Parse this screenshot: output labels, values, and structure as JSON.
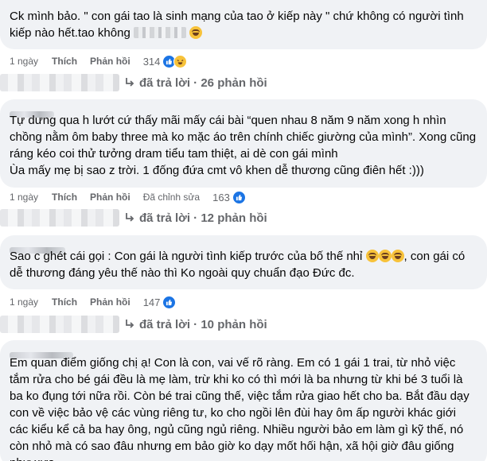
{
  "comments": [
    {
      "text_before": "Ck mình bảo. \" con gái tao là sinh mạng của tao ở kiếp này \" chứ không có người tình kiếp nào hết.tao không",
      "time": "1 ngày",
      "like": "Thích",
      "reply": "Phản hồi",
      "reaction_count": "314",
      "reactions": [
        "like-icon",
        "haha-icon"
      ],
      "replies_label": "đã trả lời · 26 phản hồi"
    },
    {
      "text": "Tự dưng qua h lướt cứ thấy mãi mấy cái bài “quen nhau 8 năm 9 năm xong h nhìn chồng nằm ôm baby three mà ko mặc áo trên chính chiếc giường của mình”. Xong cũng ráng kéo coi thử tưởng dram tiểu tam thiệt, ai dè con gái mình\nÙa mấy mẹ bị sao z trời. 1 đống đứa cmt vô khen dễ thương cũng điên hết :)))",
      "time": "1 ngày",
      "like": "Thích",
      "reply": "Phản hồi",
      "edited": "Đã chỉnh sửa",
      "reaction_count": "163",
      "reactions": [
        "like-icon"
      ],
      "replies_label": "đã trả lời · 12 phản hồi"
    },
    {
      "text_before": "Sao c ghét cái gọi : Con gái là người tình kiếp trước của bố thế nhỉ",
      "text_after": ", con gái có dễ thương đáng yêu thế nào thì Ko ngoài quy chuẩn đạo Đức đc.",
      "time": "1 ngày",
      "like": "Thích",
      "reply": "Phản hồi",
      "reaction_count": "147",
      "reactions": [
        "like-icon"
      ],
      "replies_label": "đã trả lời · 10 phản hồi"
    },
    {
      "text": "Em quan điểm giống chị ạ! Con là con, vai vế rõ ràng. Em có 1 gái 1 trai, từ nhỏ việc tắm rửa cho bé gái đều là mẹ làm, trừ khi ko có thì mới là ba nhưng từ khi bé 3 tuổi là ba ko đụng tới nữa rồi. Còn bé trai cũng thế, việc tắm rửa giao hết cho ba. Bắt đầu dạy con về việc bảo vệ các vùng riêng tư, ko cho ngồi lên đùi hay ôm ấp người khác giới các kiểu kể cả ba hay ông, ngủ cũng ngủ riêng. Nhiều người bảo em làm gì kỹ thế, nó còn nhỏ mà có sao đâu nhưng em bảo giờ ko dạy mốt hối hận, xã hội giờ đâu giống như xưa."
    }
  ],
  "colors": {
    "like_blue": "#1b74e4",
    "bubble_bg": "#f0f2f5",
    "meta_gray": "#65676b"
  }
}
